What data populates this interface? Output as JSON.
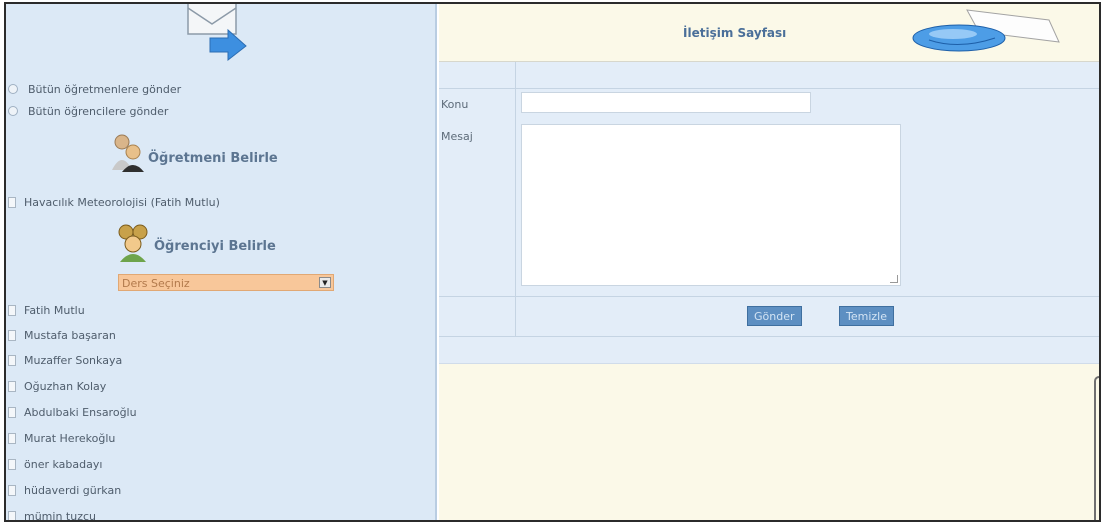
{
  "sidebar": {
    "send_all_teachers": "Bütün öğretmenlere gönder",
    "send_all_students": "Bütün öğrencilere gönder",
    "teacher_heading": "Öğretmeni Belirle",
    "teachers": [
      "Havacılık Meteorolojisi (Fatih Mutlu)"
    ],
    "student_heading": "Öğrenciyi Belirle",
    "course_select": "Ders Seçiniz",
    "students": [
      "Fatih Mutlu",
      "Mustafa başaran",
      "Muzaffer Sonkaya",
      "Oğuzhan Kolay",
      "Abdulbaki Ensaroğlu",
      "Murat Herekoğlu",
      "öner kabadayı",
      "hüdaverdi gürkan",
      "mümin tuzcu"
    ]
  },
  "header": {
    "title": "İletişim Sayfası"
  },
  "form": {
    "subject_label": "Konu",
    "subject_value": "",
    "message_label": "Mesaj",
    "message_value": "",
    "send_button": "Gönder",
    "clear_button": "Temizle"
  },
  "colors": {
    "sidebar_bg": "#dce9f6",
    "header_bg": "#fbf9e8",
    "accent": "#5d8fc2",
    "select_bg": "#f8c79a"
  },
  "icons": [
    "mail-arrow-icon",
    "teacher-icon",
    "students-icon",
    "globe-envelope-icon",
    "chevron-down-icon"
  ]
}
